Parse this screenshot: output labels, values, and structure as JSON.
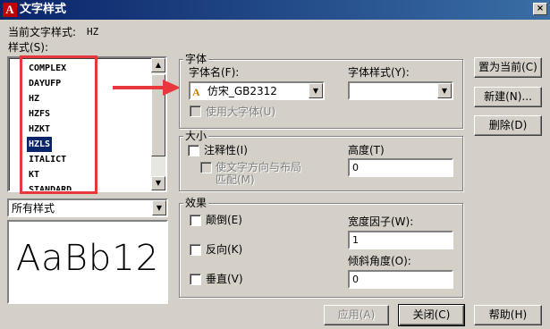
{
  "window": {
    "title": "文字样式",
    "app_icon_letter": "A",
    "close_glyph": "×"
  },
  "current_style": {
    "label": "当前文字样式:",
    "value": "HZ"
  },
  "styles": {
    "label": "样式(S):",
    "items": [
      "COMPLEX",
      "DAYUFP",
      "HZ",
      "HZFS",
      "HZKT",
      "HZLS",
      "ITALICT",
      "KT",
      "STANDARD"
    ],
    "selected": "HZLS",
    "filter_value": "所有样式"
  },
  "preview_text": "AaBb12",
  "font": {
    "group_label": "字体",
    "name_label": "字体名(F):",
    "name_value": "仿宋_GB2312",
    "style_label": "字体样式(Y):",
    "style_value": "",
    "big_font_label": "使用大字体(U)"
  },
  "size": {
    "group_label": "大小",
    "annotative_label": "注释性(I)",
    "match_orientation_label": [
      "使文字方向与布局",
      "匹配(M)"
    ],
    "height_label": "高度(T)",
    "height_value": "0"
  },
  "effects": {
    "group_label": "效果",
    "upside_down_label": "颠倒(E)",
    "backwards_label": "反向(K)",
    "vertical_label": "垂直(V)",
    "width_factor_label": "宽度因子(W):",
    "width_factor_value": "1",
    "oblique_label": "倾斜角度(O):",
    "oblique_value": "0"
  },
  "buttons": {
    "set_current": "置为当前(C)",
    "new": "新建(N)...",
    "delete": "删除(D)",
    "apply": "应用(A)",
    "close": "关闭(C)",
    "help": "帮助(H)"
  },
  "annotation": {
    "highlight_color": "#e8383d"
  },
  "colors": {
    "dialog_bg": "#d4d0c8",
    "title_gradient_start": "#0a246a",
    "title_gradient_end": "#3a6ea5",
    "selection": "#0a246a"
  }
}
